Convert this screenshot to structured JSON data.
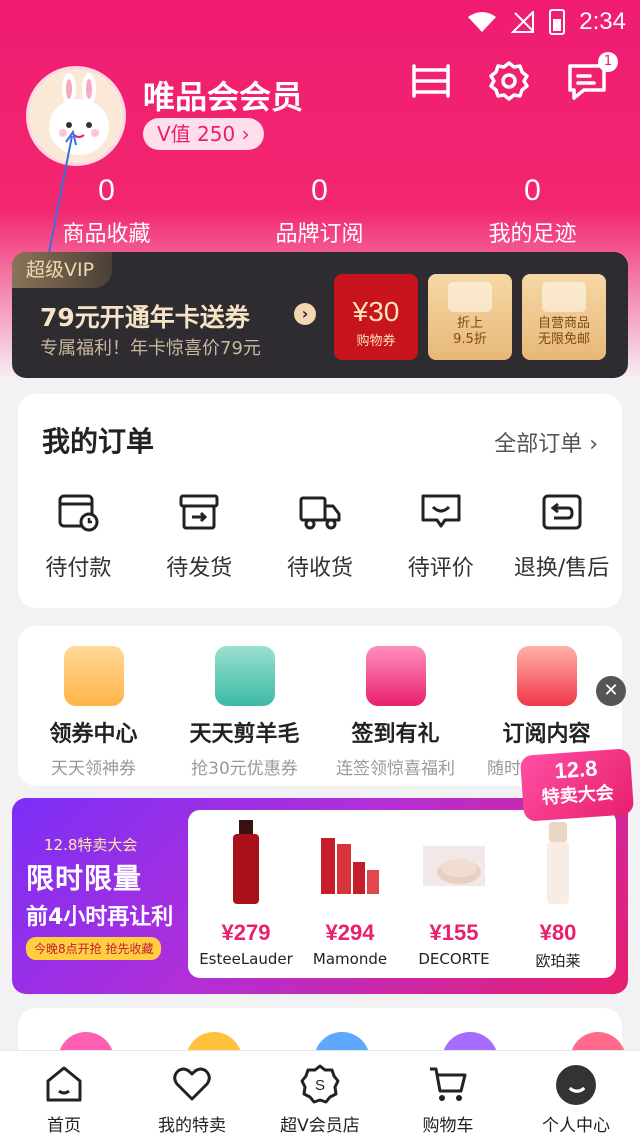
{
  "status_bar": {
    "time": "2:34"
  },
  "profile": {
    "name": "唯品会会员",
    "v_value": "V值 250 ›",
    "message_badge": "1"
  },
  "stats": [
    {
      "count": "0",
      "label": "商品收藏"
    },
    {
      "count": "0",
      "label": "品牌订阅"
    },
    {
      "count": "0",
      "label": "我的足迹"
    }
  ],
  "vip": {
    "tag": "超级VIP",
    "title": "79元开通年卡送券",
    "subtitle": "专属福利！年卡惊喜价79元",
    "coupons": [
      {
        "value": "¥30",
        "label": "购物券"
      },
      {
        "line1": "折上",
        "line2": "9.5折"
      },
      {
        "line1": "自营商品",
        "line2": "无限免邮"
      }
    ]
  },
  "orders": {
    "title": "我的订单",
    "all_label": "全部订单 ›",
    "items": [
      {
        "label": "待付款",
        "icon": "wallet-clock-icon"
      },
      {
        "label": "待发货",
        "icon": "box-icon"
      },
      {
        "label": "待收货",
        "icon": "truck-icon"
      },
      {
        "label": "待评价",
        "icon": "comment-icon"
      },
      {
        "label": "退换/售后",
        "icon": "return-icon"
      }
    ]
  },
  "services": [
    {
      "title": "领券中心",
      "subtitle": "天天领神券"
    },
    {
      "title": "天天剪羊毛",
      "subtitle": "抢30元优惠券"
    },
    {
      "title": "签到有礼",
      "subtitle": "连签领惊喜福利"
    },
    {
      "title": "订阅内容",
      "subtitle": "随时关注新动向"
    }
  ],
  "promo": {
    "event": "12.8特卖大会",
    "headline": "限时限量",
    "line2": "前4小时再让利",
    "cta": "今晚8点开抢 抢先收藏",
    "badge_num": "12.8",
    "badge_text": "特卖大会",
    "products": [
      {
        "price": "¥279",
        "brand": "EsteeLauder"
      },
      {
        "price": "¥294",
        "brand": "Mamonde"
      },
      {
        "price": "¥155",
        "brand": "DECORTE"
      },
      {
        "price": "¥80",
        "brand": "欧珀莱"
      }
    ]
  },
  "bottom_nav": [
    {
      "label": "首页",
      "icon": "home-icon"
    },
    {
      "label": "我的特卖",
      "icon": "heart-icon"
    },
    {
      "label": "超V会员店",
      "icon": "vip-store-icon"
    },
    {
      "label": "购物车",
      "icon": "cart-icon"
    },
    {
      "label": "个人中心",
      "icon": "profile-icon"
    }
  ],
  "colors": {
    "brand": "#e8206d",
    "vip_dark": "#2e2c30",
    "vip_gold": "#f3d7b0"
  }
}
